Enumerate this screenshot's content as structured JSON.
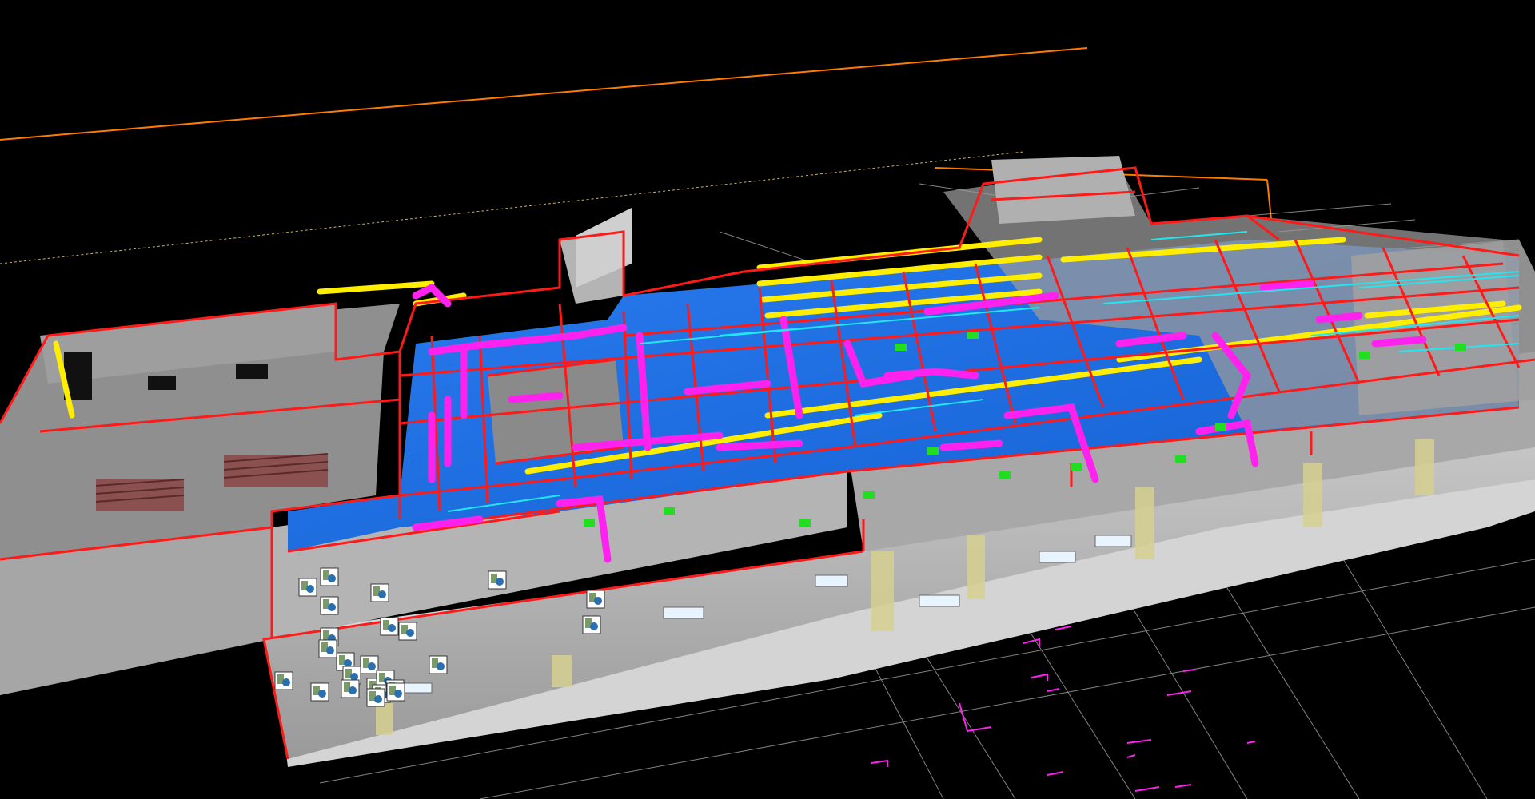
{
  "scene": {
    "background": "#000000",
    "colors": {
      "walls": "#b8b8b8",
      "walls_dark": "#8a8a8a",
      "walls_light": "#cfcfcf",
      "floor_slab": "#1e6fe0",
      "structure_red": "#ff1a1a",
      "beam_yellow": "#ffee00",
      "duct_magenta": "#ff22ee",
      "pipe_cyan": "#22e6f0",
      "equipment_green": "#22dd22",
      "grid_line": "#c6c6c6",
      "survey_orange": "#ff7a00",
      "window_light": "#e8f4ff",
      "marker_bg": "#ffffff"
    },
    "clash_marker_count": 24,
    "clash_marker_icon": "clash-report-icon"
  }
}
